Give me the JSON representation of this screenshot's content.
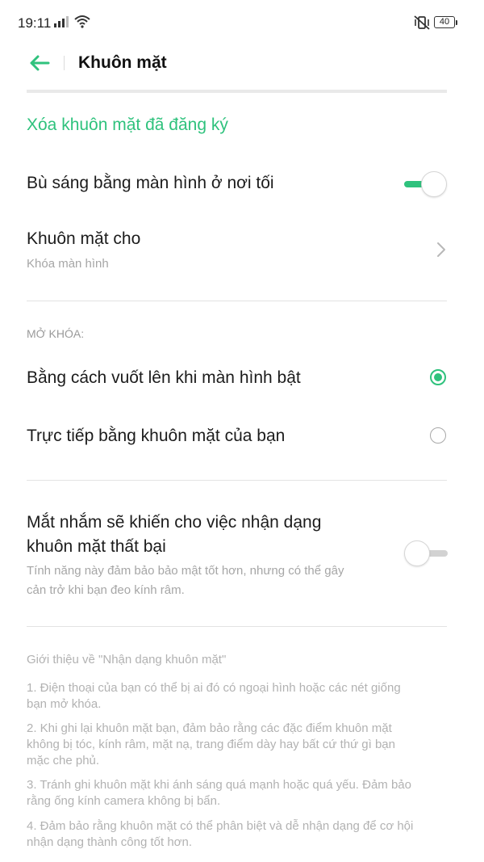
{
  "status_bar": {
    "time": "19:11",
    "battery_level": "40",
    "icons": [
      "signal-icon",
      "wifi-icon",
      "vibrate-off-icon",
      "battery-icon"
    ]
  },
  "header": {
    "title": "Khuôn mặt",
    "back_icon": "arrow-left-icon"
  },
  "colors": {
    "accent": "#2fc27d",
    "primary_text": "#1c1c1c",
    "secondary_text": "#a6a6a6"
  },
  "settings": {
    "delete_link": "Xóa khuôn mặt đã đăng ký",
    "fill_light": {
      "label": "Bù sáng bằng màn hình ở nơi tối",
      "enabled": true
    },
    "face_for": {
      "label": "Khuôn mặt cho",
      "value": "Khóa màn hình"
    }
  },
  "unlock": {
    "section_label": "MỞ KHÓA:",
    "options": [
      {
        "label": "Bằng cách vuốt lên khi màn hình bật",
        "selected": true
      },
      {
        "label": "Trực tiếp bằng khuôn mặt của bạn",
        "selected": false
      }
    ]
  },
  "closed_eyes": {
    "title_line1": "Mắt nhắm sẽ khiến cho việc nhận dạng",
    "title_line2": "khuôn mặt thất bại",
    "desc_line1": "Tính năng này đảm bảo bảo mật tốt hơn, nhưng có thể gây",
    "desc_line2": "cản trở khi bạn đeo kính râm.",
    "enabled": false
  },
  "info": {
    "title": "Giới thiệu về \"Nhận dạng khuôn mặt\"",
    "items": [
      {
        "line1": "1. Điện thoại của bạn có thể bị ai đó có ngoại hình hoặc các nét giống",
        "line2": "bạn mở khóa."
      },
      {
        "line1": "2. Khi ghi lại khuôn mặt bạn, đảm bảo rằng các đặc điểm khuôn mặt",
        "line2": "không bị tóc, kính râm, mặt nạ, trang điểm dày hay bất cứ thứ gì bạn",
        "line3": "mặc che phủ."
      },
      {
        "line1": "3. Tránh ghi khuôn mặt khi ánh sáng quá mạnh hoặc quá yếu. Đảm bảo",
        "line2": "rằng ống kính camera không bị bẩn."
      },
      {
        "line1": "4. Đảm bảo rằng khuôn mặt có thể phân biệt và dễ nhận dạng để cơ hội",
        "line2": "nhận dạng thành công tốt hơn."
      }
    ]
  }
}
